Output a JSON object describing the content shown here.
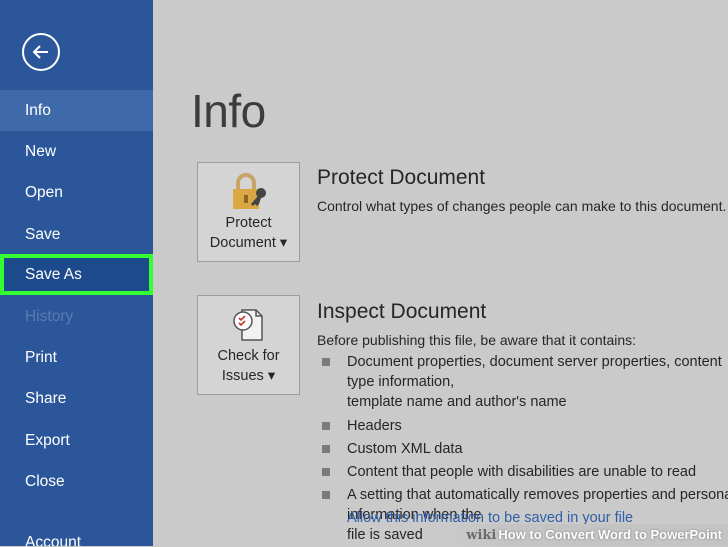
{
  "sidebar": {
    "back_icon": "back-arrow-icon",
    "items": [
      {
        "label": "Info",
        "state": "active"
      },
      {
        "label": "New",
        "state": "normal"
      },
      {
        "label": "Open",
        "state": "normal"
      },
      {
        "label": "Save",
        "state": "normal"
      },
      {
        "label": "Save As",
        "state": "highlighted"
      },
      {
        "label": "History",
        "state": "disabled"
      },
      {
        "label": "Print",
        "state": "normal"
      },
      {
        "label": "Share",
        "state": "normal"
      },
      {
        "label": "Export",
        "state": "normal"
      },
      {
        "label": "Close",
        "state": "normal"
      },
      {
        "label": "Account",
        "state": "normal"
      }
    ],
    "highlight_color": "#33ff33"
  },
  "main": {
    "title": "Info",
    "protect": {
      "button_label": "Protect\nDocument ▾",
      "icon": "lock-key-icon",
      "title": "Protect Document",
      "description": "Control what types of changes people can make to this document."
    },
    "inspect": {
      "button_label": "Check for\nIssues ▾",
      "icon": "inspect-document-icon",
      "title": "Inspect Document",
      "description": "Before publishing this file, be aware that it contains:",
      "bullets": [
        "Document properties, document server properties, content type information,\ntemplate name and author's name",
        "Headers",
        "Custom XML data",
        "Content that people with disabilities are unable to read",
        "A setting that automatically removes properties and personal information when the\nfile is saved"
      ],
      "link": "Allow this information to be saved in your file"
    }
  },
  "watermark": {
    "brand": "wiki",
    "text": "How to Convert Word to PowerPoint"
  },
  "colors": {
    "sidebar": "#2b579a",
    "background": "#cacaca"
  }
}
